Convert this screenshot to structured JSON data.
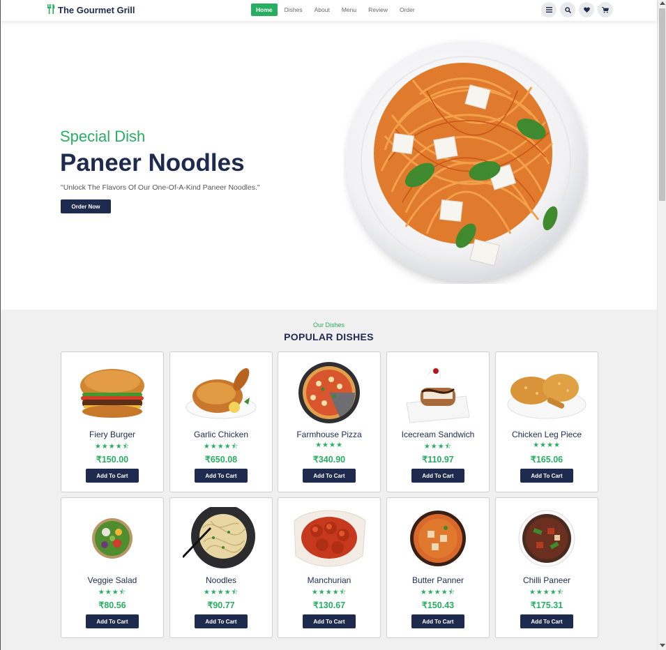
{
  "brand": {
    "name": "The Gourmet Grill",
    "accent": "#27ae60",
    "navy": "#1f2a4f"
  },
  "nav": {
    "items": [
      "Home",
      "Dishes",
      "About",
      "Menu",
      "Review",
      "Order"
    ],
    "active": "Home"
  },
  "header_icons": [
    "menu-icon",
    "search-icon",
    "heart-icon",
    "cart-icon"
  ],
  "hero": {
    "kicker": "Special Dish",
    "title": "Paneer Noodles",
    "description": "\"Unlock The Flavors Of Our One-Of-A-Kind Paneer Noodles.\"",
    "button": "Order Now"
  },
  "dishes": {
    "subheading": "Our Dishes",
    "heading": "POPULAR DISHES",
    "button_label": "Add To Cart",
    "items": [
      {
        "name": "Fiery Burger",
        "rating": 4.5,
        "price": "₹150.00"
      },
      {
        "name": "Garlic Chicken",
        "rating": 4.5,
        "price": "₹650.08"
      },
      {
        "name": "Farmhouse Pizza",
        "rating": 4,
        "price": "₹340.90"
      },
      {
        "name": "Icecream Sandwich",
        "rating": 3.5,
        "price": "₹110.97"
      },
      {
        "name": "Chicken Leg Piece",
        "rating": 4,
        "price": "₹165.06"
      },
      {
        "name": "Veggie Salad",
        "rating": 3.5,
        "price": "₹80.56"
      },
      {
        "name": "Noodles",
        "rating": 4.5,
        "price": "₹90.77"
      },
      {
        "name": "Manchurian",
        "rating": 4.5,
        "price": "₹130.67"
      },
      {
        "name": "Butter Panner",
        "rating": 4.5,
        "price": "₹150.43"
      },
      {
        "name": "Chilli Paneer",
        "rating": 4.5,
        "price": "₹175.31"
      }
    ]
  }
}
